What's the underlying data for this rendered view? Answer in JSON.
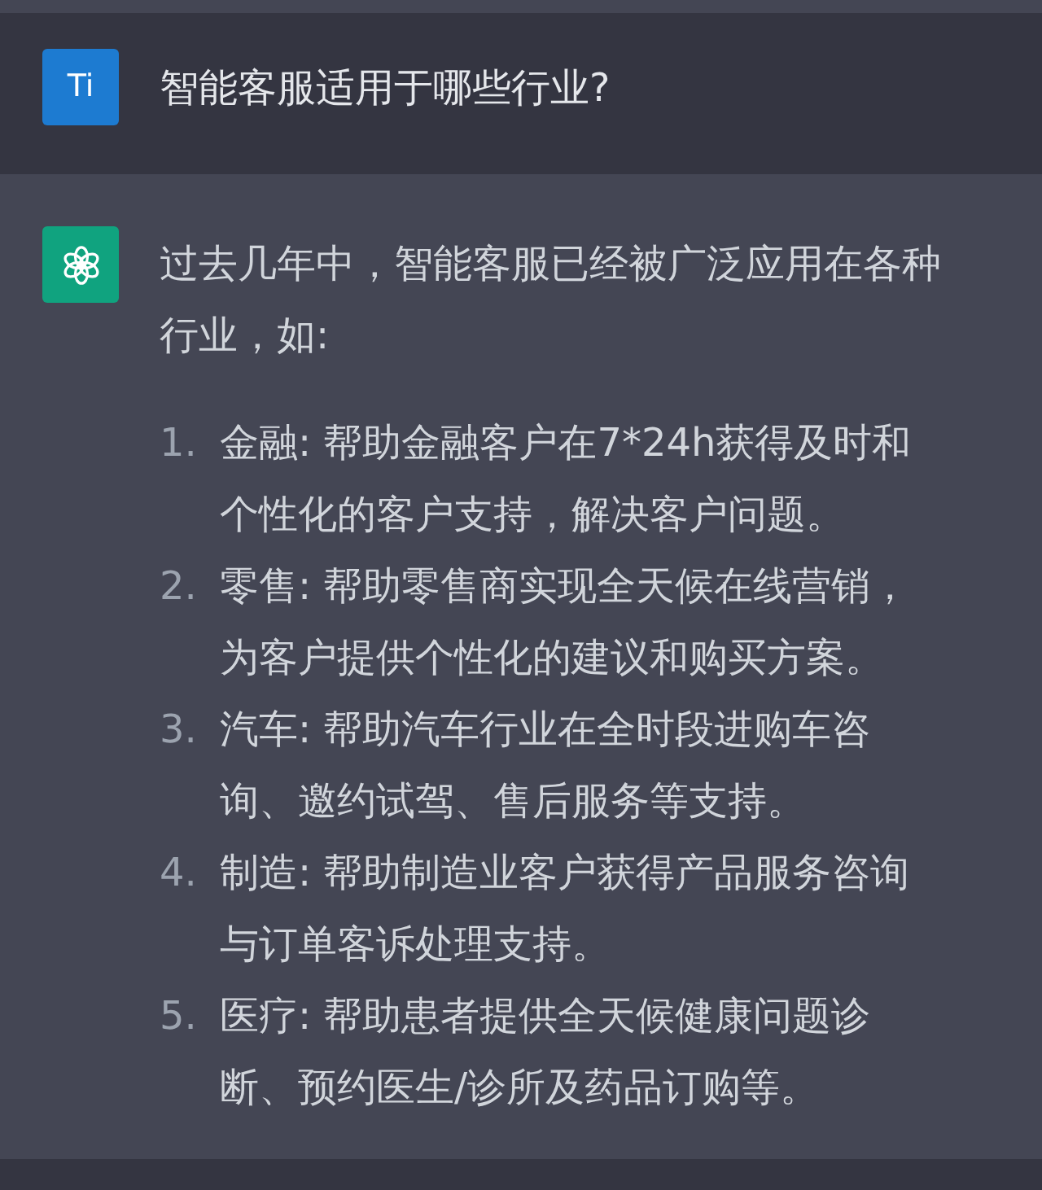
{
  "messages": [
    {
      "kind": "user",
      "avatar": "Ti",
      "text": "智能客服适用于哪些行业?"
    },
    {
      "kind": "assistant",
      "paragraphs": [
        "过去几年中，智能客服已经被广泛应用在各种行业，如:"
      ],
      "list": [
        {
          "number": "1.",
          "text": "金融: 帮助金融客户在7*24h获得及时和个性化的客户支持，解决客户问题。"
        },
        {
          "number": "2.",
          "text": "零售: 帮助零售商实现全天候在线营销，为客户提供个性化的建议和购买方案。"
        },
        {
          "number": "3.",
          "text": "汽车: 帮助汽车行业在全时段进购车咨询、邀约试驾、售后服务等支持。"
        },
        {
          "number": "4.",
          "text": "制造: 帮助制造业客户获得产品服务咨询与订单客诉处理支持。"
        },
        {
          "number": "5.",
          "text": "医疗: 帮助患者提供全天候健康问题诊断、预约医生/诊所及药品订购等。"
        }
      ]
    }
  ]
}
